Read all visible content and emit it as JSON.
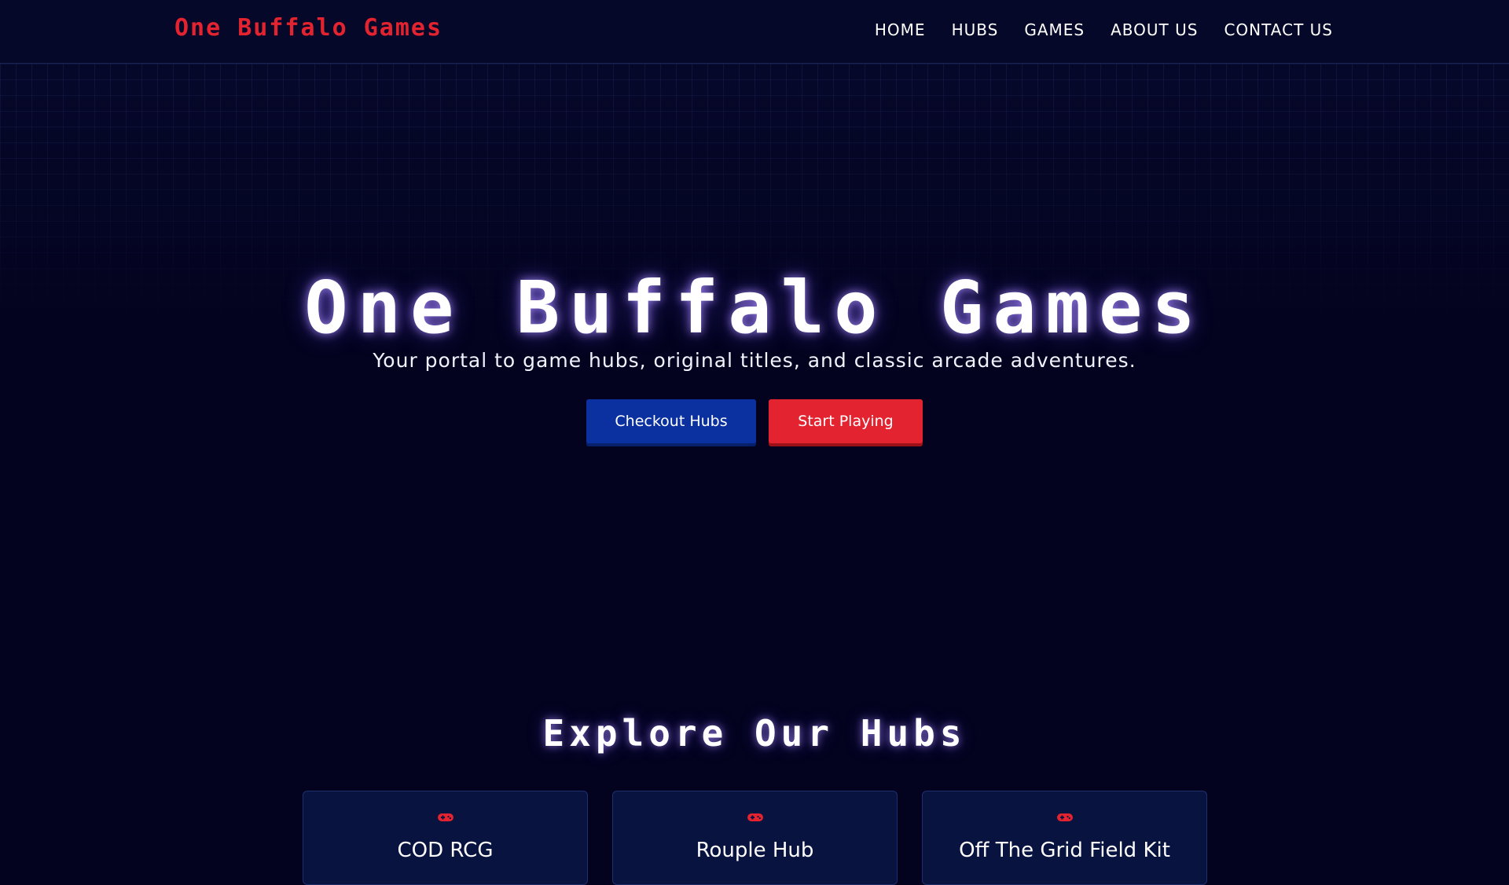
{
  "nav": {
    "logo": "One Buffalo Games",
    "links": [
      "HOME",
      "HUBS",
      "GAMES",
      "ABOUT US",
      "CONTACT US"
    ]
  },
  "hero": {
    "title": "One Buffalo Games",
    "subtitle": "Your portal to game hubs, original titles, and classic arcade adventures.",
    "buttons": {
      "hubs": "Checkout Hubs",
      "play": "Start Playing"
    }
  },
  "hubs": {
    "title": "Explore Our Hubs",
    "cards": [
      {
        "title": "COD RCG",
        "icon": "gamepad-icon"
      },
      {
        "title": "Rouple Hub",
        "icon": "gamepad-icon"
      },
      {
        "title": "Off The Grid Field Kit",
        "icon": "gamepad-icon"
      }
    ]
  },
  "colors": {
    "background": "#03031f",
    "nav_background": "#050828",
    "accent_red": "#e3232f",
    "accent_blue": "#0b31a0",
    "card_background": "#08133f"
  }
}
